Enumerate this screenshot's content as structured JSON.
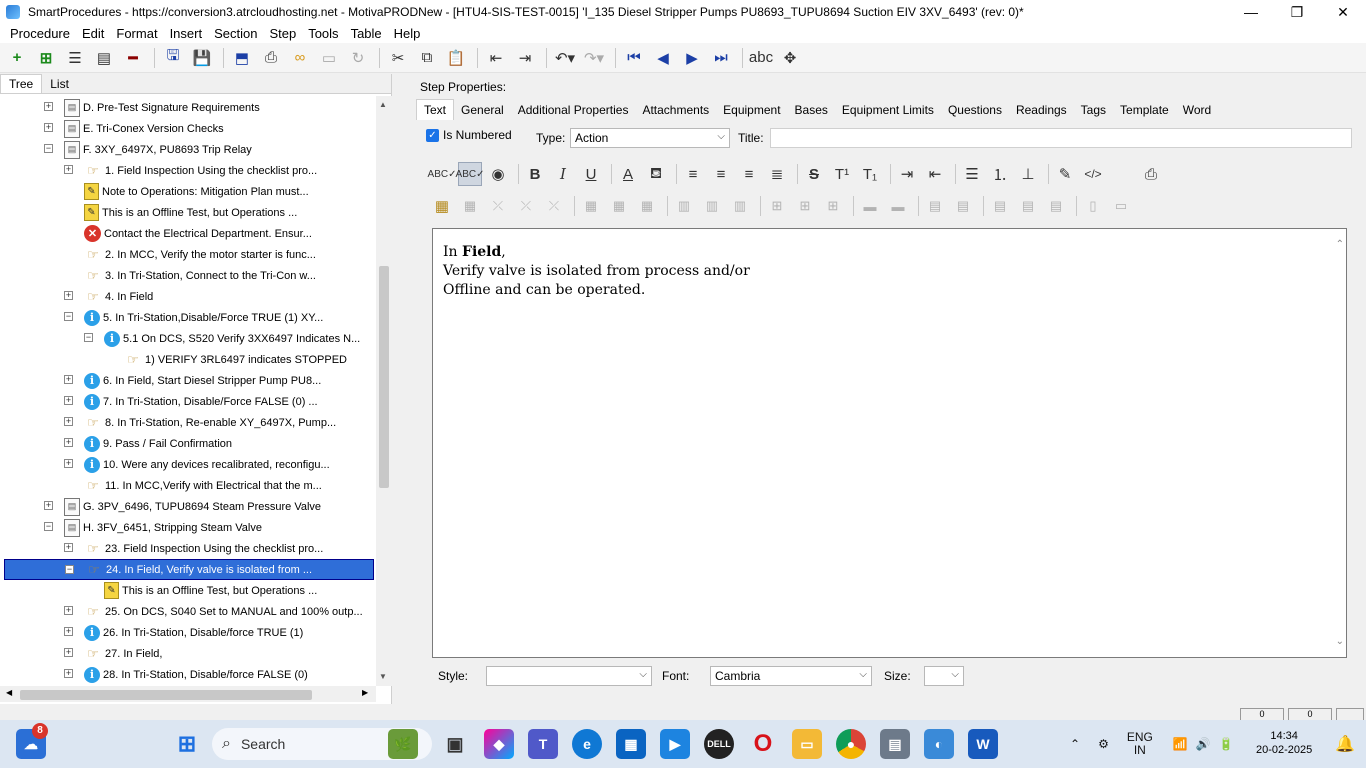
{
  "window": {
    "title": "SmartProcedures - https://conversion3.atrcloudhosting.net - MotivaPRODNew - [HTU4-SIS-TEST-0015] 'I_135 Diesel Stripper Pumps PU8693_TUPU8694 Suction EIV 3XV_6493' (rev: 0)*",
    "minimize": "—",
    "restore": "❐",
    "close": "✕"
  },
  "menu": [
    "Procedure",
    "Edit",
    "Format",
    "Insert",
    "Section",
    "Step",
    "Tools",
    "Table",
    "Help"
  ],
  "left_tabs": [
    "Tree",
    "List"
  ],
  "tree": [
    {
      "label": "D. Pre-Test Signature Requirements",
      "icon": "doc",
      "level": 0,
      "expander": "+"
    },
    {
      "label": "E. Tri-Conex Version Checks",
      "icon": "doc",
      "level": 0,
      "expander": "+"
    },
    {
      "label": "F. 3XY_6497X, PU8693 Trip Relay",
      "icon": "doc",
      "level": 0,
      "expander": "−"
    },
    {
      "label": "1. Field Inspection Using the checklist pro...",
      "icon": "hand",
      "level": 1,
      "expander": "+"
    },
    {
      "label": "Note to Operations: Mitigation Plan must...",
      "icon": "note",
      "level": 1,
      "expander": ""
    },
    {
      "label": "This is an Offline Test, but Operations ...",
      "icon": "note",
      "level": 1,
      "expander": ""
    },
    {
      "label": "Contact the Electrical Department. Ensur...",
      "icon": "error",
      "level": 1,
      "expander": ""
    },
    {
      "label": "2. In MCC, Verify the motor starter is func...",
      "icon": "hand",
      "level": 1,
      "expander": ""
    },
    {
      "label": "3. In Tri-Station, Connect to the Tri-Con w...",
      "icon": "hand",
      "level": 1,
      "expander": ""
    },
    {
      "label": "4. In Field",
      "icon": "hand",
      "level": 1,
      "expander": "+"
    },
    {
      "label": "5. In Tri-Station,Disable/Force TRUE (1) XY...",
      "icon": "info",
      "level": 1,
      "expander": "−"
    },
    {
      "label": "5.1  On DCS, S520 Verify 3XX6497 Indicates N...",
      "icon": "info",
      "level": 2,
      "expander": "−"
    },
    {
      "label": "1) VERIFY 3RL6497 indicates STOPPED",
      "icon": "hand",
      "level": 3,
      "expander": ""
    },
    {
      "label": "6. In Field, Start Diesel Stripper Pump PU8...",
      "icon": "info",
      "level": 1,
      "expander": "+"
    },
    {
      "label": "7. In Tri-Station, Disable/Force FALSE (0) ...",
      "icon": "info",
      "level": 1,
      "expander": "+"
    },
    {
      "label": "8. In Tri-Station, Re-enable XY_6497X, Pump...",
      "icon": "hand",
      "level": 1,
      "expander": "+"
    },
    {
      "label": "9. Pass / Fail Confirmation",
      "icon": "info",
      "level": 1,
      "expander": "+"
    },
    {
      "label": "10. Were any devices recalibrated, reconfigu...",
      "icon": "info",
      "level": 1,
      "expander": "+"
    },
    {
      "label": "11. In MCC,Verify with Electrical that the m...",
      "icon": "hand",
      "level": 1,
      "expander": ""
    },
    {
      "label": "G. 3PV_6496, TUPU8694 Steam Pressure Valve",
      "icon": "doc",
      "level": 0,
      "expander": "+"
    },
    {
      "label": "H. 3FV_6451, Stripping Steam Valve",
      "icon": "doc",
      "level": 0,
      "expander": "−"
    },
    {
      "label": "23. Field Inspection Using the checklist pro...",
      "icon": "hand",
      "level": 1,
      "expander": "+"
    },
    {
      "label": "24. In Field, Verify valve is isolated from ...",
      "icon": "hand",
      "level": 1,
      "expander": "−",
      "selected": true
    },
    {
      "label": "This is an Offline Test, but Operations ...",
      "icon": "note",
      "level": 2,
      "expander": ""
    },
    {
      "label": "25. On DCS, S040 Set to MANUAL and 100% outp...",
      "icon": "hand",
      "level": 1,
      "expander": "+"
    },
    {
      "label": "26. In Tri-Station, Disable/force TRUE (1)",
      "icon": "info",
      "level": 1,
      "expander": "+"
    },
    {
      "label": "27. In Field,",
      "icon": "hand",
      "level": 1,
      "expander": "+"
    },
    {
      "label": "28. In Tri-Station, Disable/force FALSE (0)",
      "icon": "info",
      "level": 1,
      "expander": "+"
    }
  ],
  "step_props": {
    "label": "Step Properties:",
    "tabs": [
      "Text",
      "General",
      "Additional Properties",
      "Attachments",
      "Equipment",
      "Bases",
      "Equipment Limits",
      "Questions",
      "Readings",
      "Tags",
      "Template",
      "Word"
    ],
    "is_numbered_label": "Is Numbered",
    "type_label": "Type:",
    "type_value": "Action",
    "title_label": "Title:",
    "title_value": ""
  },
  "editor": {
    "line1_prefix": "In ",
    "line1_bold": "Field",
    "line1_suffix": ",",
    "line2": "Verify valve is isolated from process and/or",
    "line3": "Offline and can be operated."
  },
  "bottom": {
    "style_label": "Style:",
    "style_value": "",
    "font_label": "Font:",
    "font_value": "Cambria",
    "size_label": "Size:",
    "size_value": ""
  },
  "status": {
    "box1": "0",
    "box2": "0"
  },
  "taskbar": {
    "search": "Search",
    "notification_count": "8",
    "lang_top": "ENG",
    "lang_bottom": "IN",
    "time": "14:34",
    "date": "20-02-2025"
  }
}
